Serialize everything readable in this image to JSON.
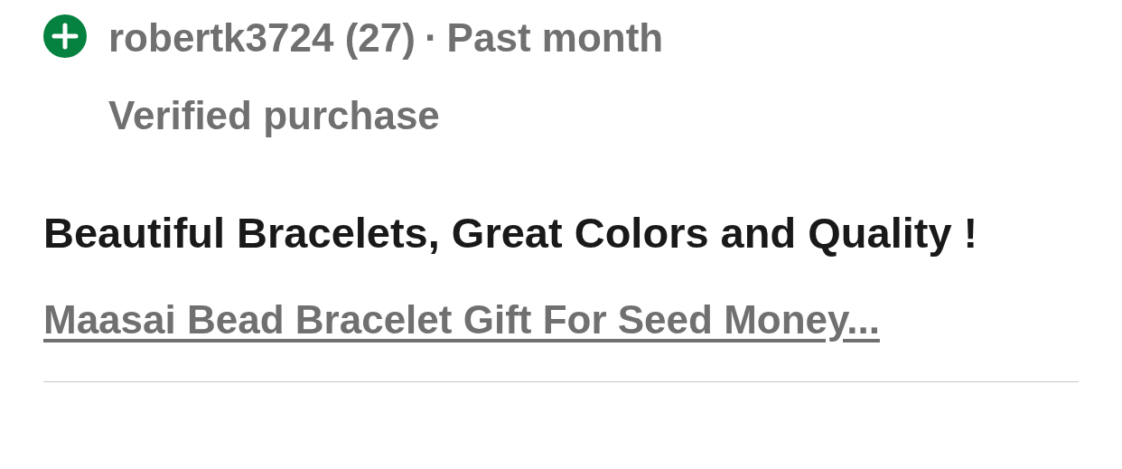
{
  "review": {
    "reviewer": "robertk3724 (27)",
    "separator": "·",
    "time": "Past month",
    "verified": "Verified purchase",
    "title": "Beautiful Bracelets, Great Colors and Quality !",
    "item_link": "Maasai Bead Bracelet Gift For Seed Money..."
  }
}
